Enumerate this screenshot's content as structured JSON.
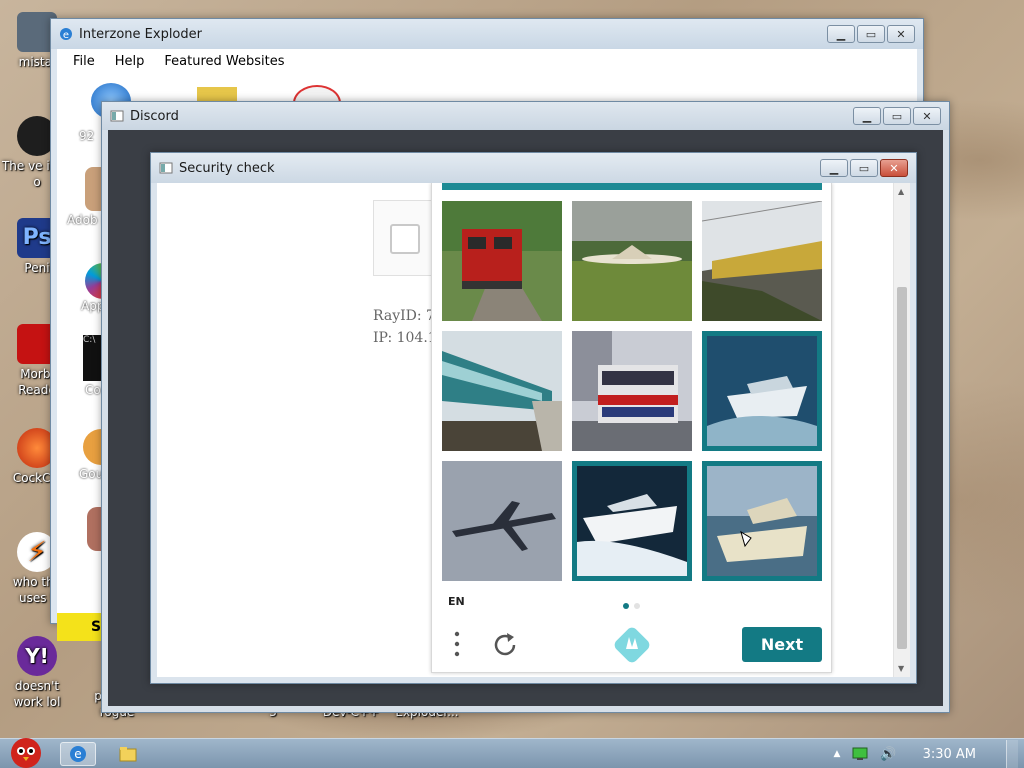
{
  "desktop": {
    "icons": [
      {
        "label": "mistal",
        "color": "#556677"
      },
      {
        "label": "The ve idea o",
        "color": "#222222"
      },
      {
        "label": "Peni",
        "color": "#2a3f8f"
      },
      {
        "label": "Morbi Reade",
        "color": "#c01818"
      },
      {
        "label": "CockCle",
        "color": "#d04020"
      },
      {
        "label": "who the uses t",
        "color": "#f07010"
      },
      {
        "label": "doesn't work lol",
        "color": "#6a2a9a"
      }
    ],
    "bottom_labels": [
      "pi not a rogue",
      "3",
      "Dev-C++",
      "Exploder..."
    ]
  },
  "ie_window": {
    "title": "Interzone Exploder",
    "menu": [
      "File",
      "Help",
      "Featured Websites"
    ],
    "icon_labels": [
      "92",
      "Adob Playe",
      "App",
      "Co",
      "Gou"
    ],
    "banner_text": "S"
  },
  "discord_window": {
    "title": "Discord"
  },
  "security_window": {
    "title": "Security check",
    "cloudflare": {
      "ray_id": "RayID: 7",
      "ip": "IP: 104.1"
    },
    "captcha": {
      "accent": "#137a84",
      "tiles": [
        {
          "name": "tile-red-train",
          "subject": "red locomotive",
          "selected": false
        },
        {
          "name": "tile-airplane-runway",
          "subject": "airplane on runway",
          "selected": false
        },
        {
          "name": "tile-train-platform",
          "subject": "train at platform",
          "selected": false
        },
        {
          "name": "tile-teal-train",
          "subject": "teal passenger train",
          "selected": false
        },
        {
          "name": "tile-double-decker-bus",
          "subject": "double decker bus",
          "selected": false
        },
        {
          "name": "tile-speedboat-1",
          "subject": "speedboat",
          "selected": true
        },
        {
          "name": "tile-airplane-flying",
          "subject": "airplane in flight",
          "selected": false
        },
        {
          "name": "tile-speedboat-2",
          "subject": "speedboat",
          "selected": true
        },
        {
          "name": "tile-yacht",
          "subject": "yacht",
          "selected": true
        }
      ],
      "language": "EN",
      "next_label": "Next"
    }
  },
  "taskbar": {
    "clock": "3:30 AM"
  }
}
